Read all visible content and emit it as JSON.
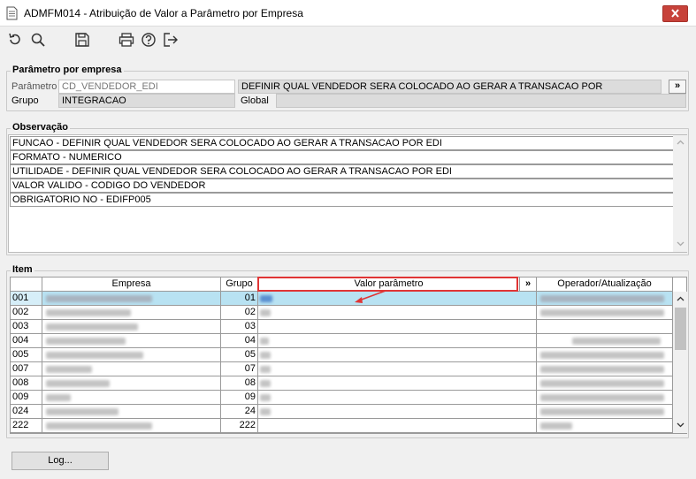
{
  "window": {
    "title": "ADMFM014 - Atribuição de Valor a Parâmetro por Empresa",
    "close_label": "×"
  },
  "toolbar": {
    "icons": [
      "refresh-icon",
      "search-icon",
      "save-icon",
      "print-icon",
      "help-icon",
      "exit-icon"
    ]
  },
  "parametro_por_empresa": {
    "group_title": "Parâmetro por empresa",
    "parametro_label": "Parâmetro",
    "parametro_value": "CD_VENDEDOR_EDI",
    "descricao_value": "DEFINIR QUAL VENDEDOR SERA COLOCADO AO GERAR A TRANSACAO POR",
    "more_button": "»",
    "grupo_label": "Grupo",
    "grupo_value": "INTEGRACAO",
    "global_label": "Global",
    "global_value": ""
  },
  "observacao": {
    "group_title": "Observação",
    "lines": [
      "FUNCAO -  DEFINIR QUAL VENDEDOR SERA COLOCADO AO GERAR A TRANSACAO POR EDI",
      "FORMATO - NUMERICO",
      "UTILIDADE - DEFINIR QUAL VENDEDOR SERA COLOCADO AO GERAR A TRANSACAO POR EDI",
      "VALOR VALIDO - CODIGO DO VENDEDOR",
      "OBRIGATORIO NO - EDIFP005"
    ]
  },
  "item": {
    "group_title": "Item",
    "columns": {
      "empresa": "Empresa",
      "grupo": "Grupo",
      "valor": "Valor parâmetro",
      "more": "»",
      "operador": "Operador/Atualização"
    },
    "rows": [
      {
        "code": "001",
        "grupo": "01"
      },
      {
        "code": "002",
        "grupo": "02"
      },
      {
        "code": "003",
        "grupo": "03"
      },
      {
        "code": "004",
        "grupo": "04"
      },
      {
        "code": "005",
        "grupo": "05"
      },
      {
        "code": "007",
        "grupo": "07"
      },
      {
        "code": "008",
        "grupo": "08"
      },
      {
        "code": "009",
        "grupo": "09"
      },
      {
        "code": "024",
        "grupo": "24"
      },
      {
        "code": "222",
        "grupo": "222"
      }
    ]
  },
  "footer": {
    "log_button": "Log..."
  },
  "colors": {
    "close": "#c7423a",
    "selected_row": "#b8e2f2",
    "annotation_red": "#e03535"
  }
}
